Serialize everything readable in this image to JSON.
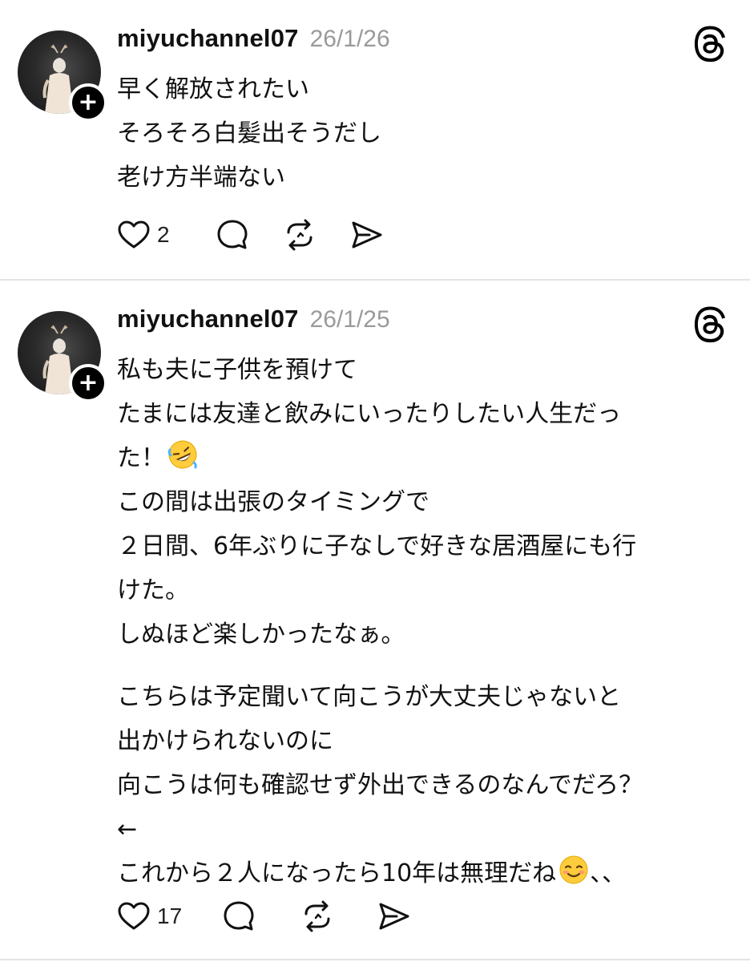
{
  "posts": [
    {
      "username": "miyuchannel07",
      "timestamp": "26/1/26",
      "lines": [
        "早く解放されたい",
        "そろそろ白髪出そうだし",
        "老け方半端ない"
      ],
      "like_count": "2",
      "icons": [
        "heart-icon",
        "comment-icon",
        "repost-icon",
        "share-icon"
      ]
    },
    {
      "username": "miyuchannel07",
      "timestamp": "26/1/25",
      "paragraph1": [
        "私も夫に子供を預けて",
        "たまには友達と飲みにいったりしたい人生だっ",
        "た！",
        "この間は出張のタイミングで",
        "２日間、6年ぶりに子なしで好きな居酒屋にも行",
        "けた。",
        "しぬほど楽しかったなぁ。"
      ],
      "paragraph2": [
        "こちらは予定聞いて向こうが大丈夫じゃないと",
        "出かけられないのに",
        "向こうは何も確認せず外出できるのなんでだろ？",
        "←",
        "これから２人になったら10年は無理だね",
        "、、"
      ],
      "emojis": [
        "rolling-on-floor-laughing-emoji",
        "smiling-face-emoji"
      ],
      "like_count": "17",
      "icons": [
        "heart-icon",
        "comment-icon",
        "repost-icon",
        "share-icon"
      ]
    }
  ],
  "colors": {
    "text": "#111111",
    "timestamp": "#9a9a9a",
    "divider": "#e3e3e3",
    "badge": "#000000"
  }
}
